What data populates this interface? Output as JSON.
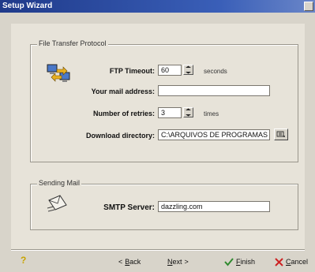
{
  "window": {
    "title": "Setup Wizard"
  },
  "ftp_group": {
    "legend": "File Transfer Protocol",
    "timeout_label": "FTP Timeout:",
    "timeout_value": "60",
    "timeout_unit": "seconds",
    "mail_label": "Your mail address:",
    "mail_value": "",
    "retries_label": "Number of retries:",
    "retries_value": "3",
    "retries_unit": "times",
    "dir_label": "Download directory:",
    "dir_value": "C:\\ARQUIVOS DE PROGRAMAS"
  },
  "mail_group": {
    "legend": "Sending Mail",
    "smtp_label": "SMTP Server:",
    "smtp_value": "dazzling.com"
  },
  "footer": {
    "help_glyph": "?",
    "back_first": "B",
    "back_rest": "ack",
    "back_prefix": "<",
    "next_first": "N",
    "next_rest": "ext",
    "next_suffix": ">",
    "finish_first": "F",
    "finish_rest": "inish",
    "cancel_first": "C",
    "cancel_rest": "ancel"
  },
  "icons": {
    "ftp": "network-transfer-icon",
    "mail": "envelope-icon",
    "finish": "check-icon",
    "cancel": "cross-icon",
    "help": "help-icon",
    "browse": "folder-browse-icon",
    "spin": "spin-arrows-icon"
  },
  "colors": {
    "titlebar": "#1f3a8a",
    "finish": "#2f8a2f",
    "cancel": "#cc2222",
    "help": "#c8a400"
  }
}
